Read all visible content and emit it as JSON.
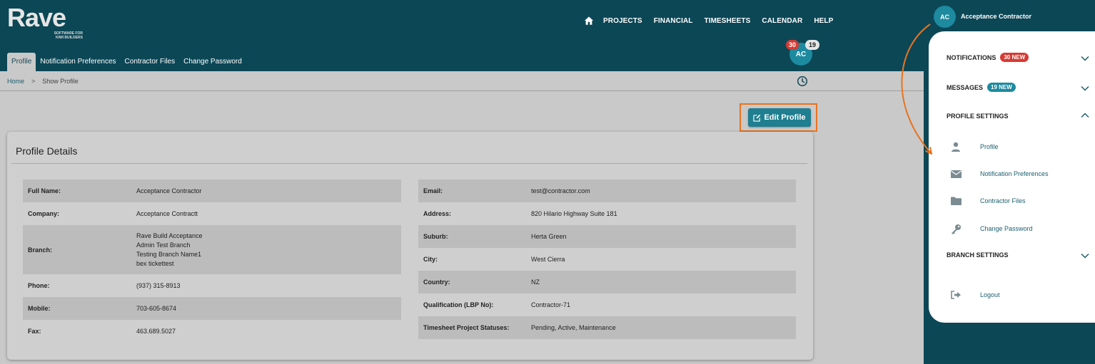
{
  "brand": {
    "name": "Rave",
    "tagline_line1": "SOFTWARE FOR",
    "tagline_line2": "KIWI BUILDERS"
  },
  "topnav": [
    "PROJECTS",
    "FINANCIAL",
    "TIMESHEETS",
    "CALENDAR",
    "HELP"
  ],
  "user": {
    "initials": "AC",
    "name": "Acceptance Contractor",
    "notification_count": "30",
    "message_count": "19"
  },
  "tabs": [
    {
      "label": "Profile",
      "active": true
    },
    {
      "label": "Notification Preferences",
      "active": false
    },
    {
      "label": "Contractor Files",
      "active": false
    },
    {
      "label": "Change Password",
      "active": false
    }
  ],
  "breadcrumb": {
    "home": "Home",
    "separator": ">",
    "current": "Show Profile"
  },
  "edit_button": {
    "label": "Edit Profile"
  },
  "profile": {
    "title": "Profile Details",
    "left": [
      {
        "label": "Full Name:",
        "value": "Acceptance Contractor"
      },
      {
        "label": "Company:",
        "value": "Acceptance Contractt"
      },
      {
        "label": "Branch:",
        "lines": [
          "Rave Build Acceptance",
          "Admin Test Branch",
          "Testing Branch Name1",
          "bex tickettest"
        ]
      },
      {
        "label": "Phone:",
        "value": "(937) 315-8913"
      },
      {
        "label": "Mobile:",
        "value": "703-605-8674"
      },
      {
        "label": "Fax:",
        "value": "463.689.5027"
      }
    ],
    "right": [
      {
        "label": "Email:",
        "value": "test@contractor.com"
      },
      {
        "label": "Address:",
        "value": "820 Hilario Highway Suite 181"
      },
      {
        "label": "Suburb:",
        "value": "Herta Green"
      },
      {
        "label": "City:",
        "value": "West Cierra"
      },
      {
        "label": "Country:",
        "value": "NZ"
      },
      {
        "label": "Qualification (LBP No):",
        "value": "Contractor-71"
      },
      {
        "label": "Timesheet Project Statuses:",
        "value": "Pending, Active, Maintenance"
      }
    ]
  },
  "panel": {
    "notifications": {
      "label": "NOTIFICATIONS",
      "badge": "30 NEW"
    },
    "messages": {
      "label": "MESSAGES",
      "badge": "19 NEW"
    },
    "profile_settings": {
      "label": "PROFILE SETTINGS"
    },
    "profile_items": [
      {
        "label": "Profile",
        "icon": "person-icon"
      },
      {
        "label": "Notification Preferences",
        "icon": "envelope-icon"
      },
      {
        "label": "Contractor Files",
        "icon": "folder-icon"
      },
      {
        "label": "Change Password",
        "icon": "key-icon"
      }
    ],
    "branch_settings": {
      "label": "BRANCH SETTINGS"
    },
    "logout": {
      "label": "Logout",
      "icon": "logout-icon"
    }
  },
  "colors": {
    "header": "#0c4756",
    "accent": "#1f7f90",
    "highlight": "#e8731f",
    "badge_red": "#d63b33"
  }
}
